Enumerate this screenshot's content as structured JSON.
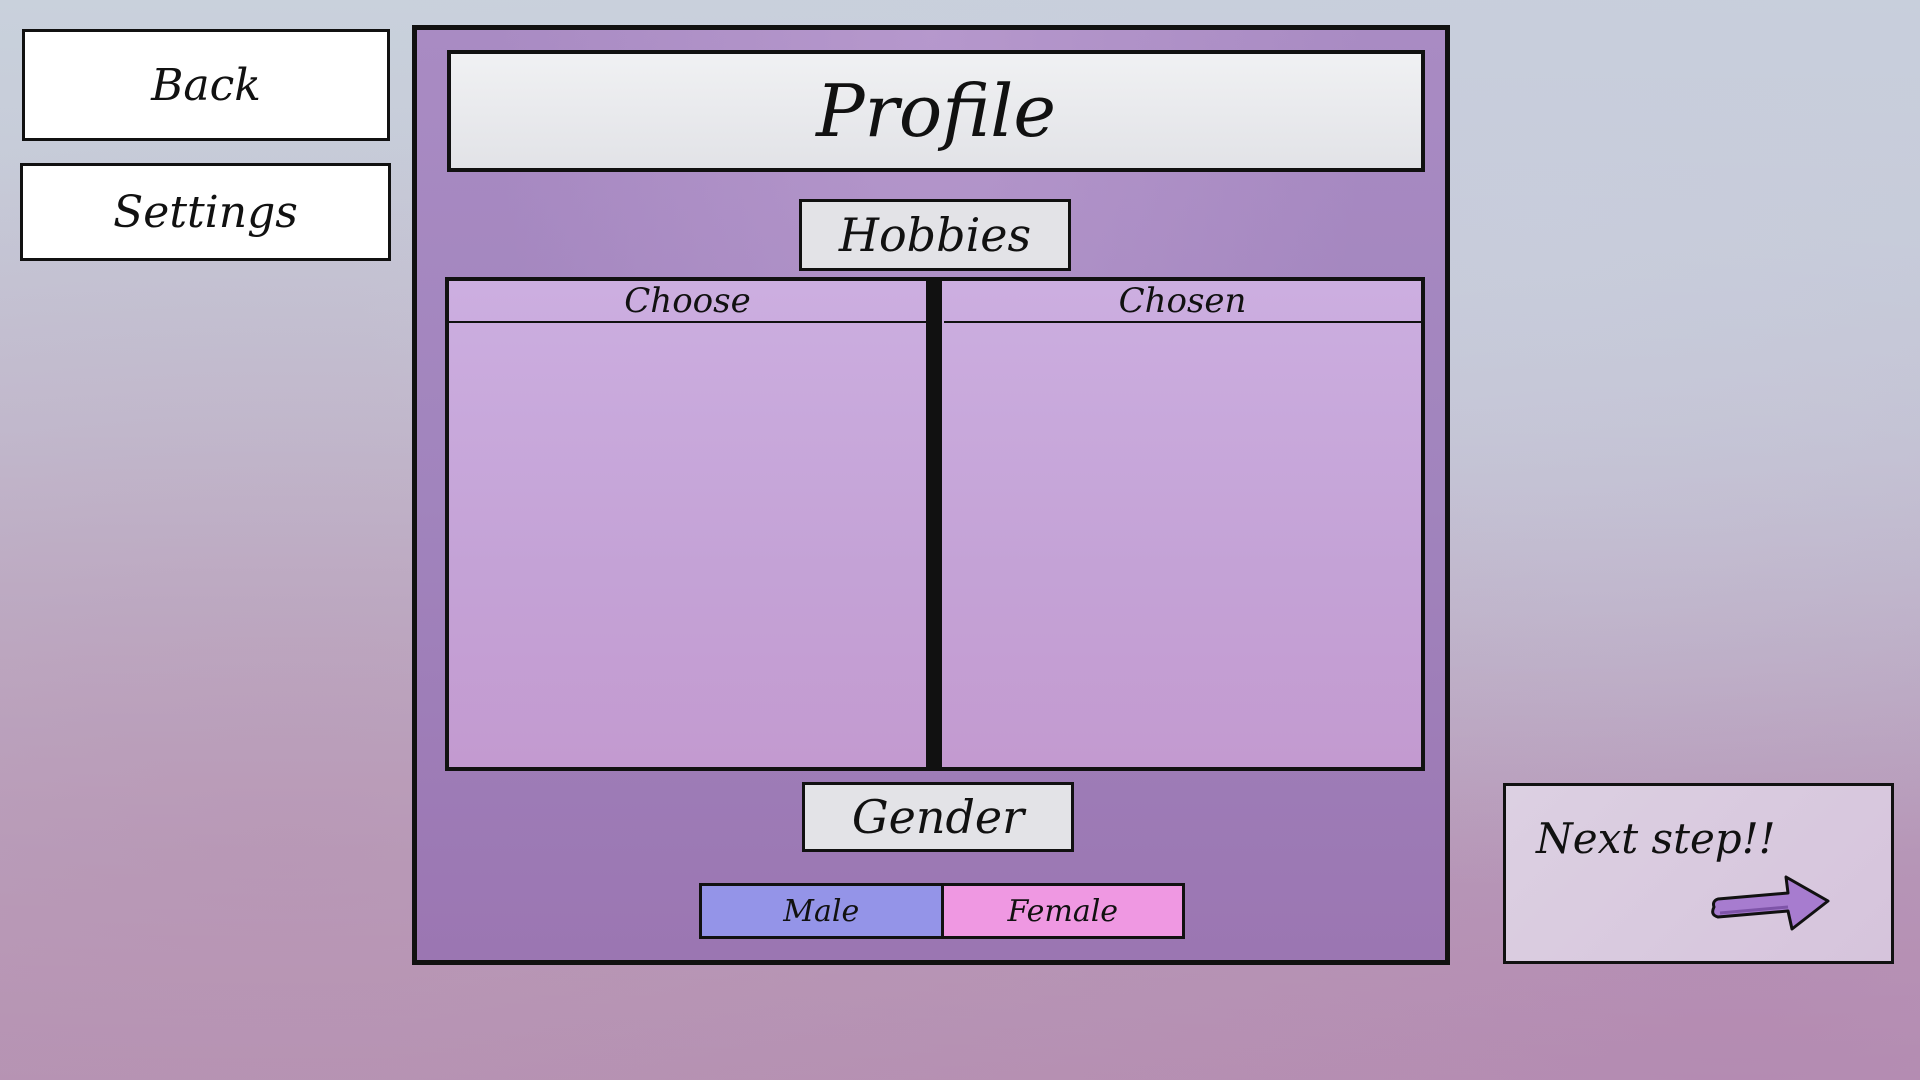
{
  "nav": {
    "back_label": "Back",
    "settings_label": "Settings"
  },
  "panel": {
    "title": "Profile",
    "hobbies_label": "Hobbies",
    "choose_header": "Choose",
    "chosen_header": "Chosen",
    "gender_label": "Gender",
    "gender_options": [
      "Male",
      "Female"
    ]
  },
  "next": {
    "label": "Next step!!"
  },
  "colors": {
    "male": "#9494e8",
    "female": "#ef98e2",
    "panel": "#a184bd"
  },
  "icons": {
    "next_arrow": "arrow-right-icon"
  }
}
